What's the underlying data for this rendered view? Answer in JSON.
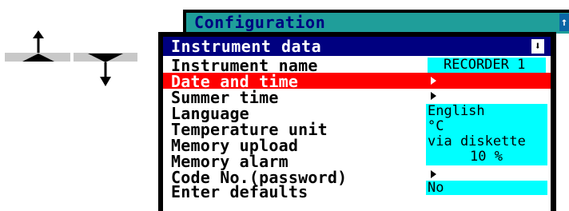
{
  "background_window": {
    "title": "Configuration",
    "corner_icon": "up-arrow-icon"
  },
  "panel": {
    "title": "Instrument data",
    "header_icon": "down-arrow-icon",
    "rows": [
      {
        "label": "Instrument name",
        "value": "RECORDER 1",
        "kind": "value"
      },
      {
        "label": "Date and time",
        "value": "",
        "kind": "submenu",
        "selected": true
      },
      {
        "label": "Summer time",
        "value": "",
        "kind": "submenu"
      },
      {
        "label": "Language",
        "value": "English",
        "kind": "value"
      },
      {
        "label": "Temperature unit",
        "value": "°C",
        "kind": "value"
      },
      {
        "label": "Memory upload",
        "value": "via diskette",
        "kind": "value"
      },
      {
        "label": "Memory alarm",
        "value": "10 %",
        "kind": "value"
      },
      {
        "label": "Code No.(password)",
        "value": "",
        "kind": "submenu"
      },
      {
        "label": "Enter defaults",
        "value": "No",
        "kind": "value"
      }
    ]
  },
  "keys": {
    "up": "up-key-icon",
    "down": "down-key-icon"
  },
  "colors": {
    "header": "#000080",
    "selection": "#ff0000",
    "value_bg": "#00ffff",
    "teal": "#1f9e9a"
  }
}
